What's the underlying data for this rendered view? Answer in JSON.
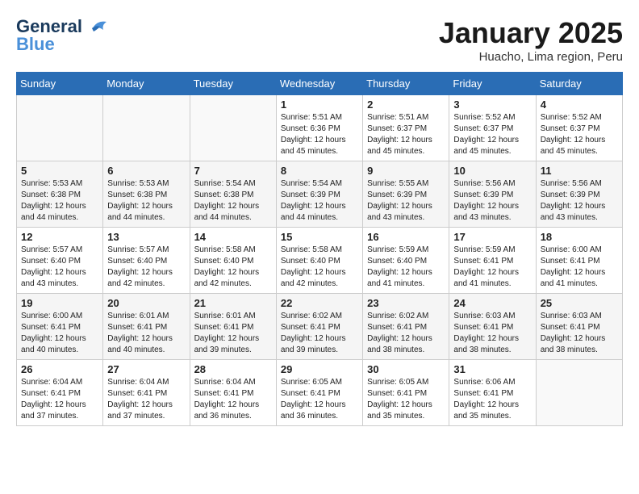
{
  "header": {
    "logo_line1": "General",
    "logo_line2": "Blue",
    "title": "January 2025",
    "subtitle": "Huacho, Lima region, Peru"
  },
  "weekdays": [
    "Sunday",
    "Monday",
    "Tuesday",
    "Wednesday",
    "Thursday",
    "Friday",
    "Saturday"
  ],
  "weeks": [
    [
      {
        "day": "",
        "sunrise": "",
        "sunset": "",
        "daylight": ""
      },
      {
        "day": "",
        "sunrise": "",
        "sunset": "",
        "daylight": ""
      },
      {
        "day": "",
        "sunrise": "",
        "sunset": "",
        "daylight": ""
      },
      {
        "day": "1",
        "sunrise": "Sunrise: 5:51 AM",
        "sunset": "Sunset: 6:36 PM",
        "daylight": "Daylight: 12 hours and 45 minutes."
      },
      {
        "day": "2",
        "sunrise": "Sunrise: 5:51 AM",
        "sunset": "Sunset: 6:37 PM",
        "daylight": "Daylight: 12 hours and 45 minutes."
      },
      {
        "day": "3",
        "sunrise": "Sunrise: 5:52 AM",
        "sunset": "Sunset: 6:37 PM",
        "daylight": "Daylight: 12 hours and 45 minutes."
      },
      {
        "day": "4",
        "sunrise": "Sunrise: 5:52 AM",
        "sunset": "Sunset: 6:37 PM",
        "daylight": "Daylight: 12 hours and 45 minutes."
      }
    ],
    [
      {
        "day": "5",
        "sunrise": "Sunrise: 5:53 AM",
        "sunset": "Sunset: 6:38 PM",
        "daylight": "Daylight: 12 hours and 44 minutes."
      },
      {
        "day": "6",
        "sunrise": "Sunrise: 5:53 AM",
        "sunset": "Sunset: 6:38 PM",
        "daylight": "Daylight: 12 hours and 44 minutes."
      },
      {
        "day": "7",
        "sunrise": "Sunrise: 5:54 AM",
        "sunset": "Sunset: 6:38 PM",
        "daylight": "Daylight: 12 hours and 44 minutes."
      },
      {
        "day": "8",
        "sunrise": "Sunrise: 5:54 AM",
        "sunset": "Sunset: 6:39 PM",
        "daylight": "Daylight: 12 hours and 44 minutes."
      },
      {
        "day": "9",
        "sunrise": "Sunrise: 5:55 AM",
        "sunset": "Sunset: 6:39 PM",
        "daylight": "Daylight: 12 hours and 43 minutes."
      },
      {
        "day": "10",
        "sunrise": "Sunrise: 5:56 AM",
        "sunset": "Sunset: 6:39 PM",
        "daylight": "Daylight: 12 hours and 43 minutes."
      },
      {
        "day": "11",
        "sunrise": "Sunrise: 5:56 AM",
        "sunset": "Sunset: 6:39 PM",
        "daylight": "Daylight: 12 hours and 43 minutes."
      }
    ],
    [
      {
        "day": "12",
        "sunrise": "Sunrise: 5:57 AM",
        "sunset": "Sunset: 6:40 PM",
        "daylight": "Daylight: 12 hours and 43 minutes."
      },
      {
        "day": "13",
        "sunrise": "Sunrise: 5:57 AM",
        "sunset": "Sunset: 6:40 PM",
        "daylight": "Daylight: 12 hours and 42 minutes."
      },
      {
        "day": "14",
        "sunrise": "Sunrise: 5:58 AM",
        "sunset": "Sunset: 6:40 PM",
        "daylight": "Daylight: 12 hours and 42 minutes."
      },
      {
        "day": "15",
        "sunrise": "Sunrise: 5:58 AM",
        "sunset": "Sunset: 6:40 PM",
        "daylight": "Daylight: 12 hours and 42 minutes."
      },
      {
        "day": "16",
        "sunrise": "Sunrise: 5:59 AM",
        "sunset": "Sunset: 6:40 PM",
        "daylight": "Daylight: 12 hours and 41 minutes."
      },
      {
        "day": "17",
        "sunrise": "Sunrise: 5:59 AM",
        "sunset": "Sunset: 6:41 PM",
        "daylight": "Daylight: 12 hours and 41 minutes."
      },
      {
        "day": "18",
        "sunrise": "Sunrise: 6:00 AM",
        "sunset": "Sunset: 6:41 PM",
        "daylight": "Daylight: 12 hours and 41 minutes."
      }
    ],
    [
      {
        "day": "19",
        "sunrise": "Sunrise: 6:00 AM",
        "sunset": "Sunset: 6:41 PM",
        "daylight": "Daylight: 12 hours and 40 minutes."
      },
      {
        "day": "20",
        "sunrise": "Sunrise: 6:01 AM",
        "sunset": "Sunset: 6:41 PM",
        "daylight": "Daylight: 12 hours and 40 minutes."
      },
      {
        "day": "21",
        "sunrise": "Sunrise: 6:01 AM",
        "sunset": "Sunset: 6:41 PM",
        "daylight": "Daylight: 12 hours and 39 minutes."
      },
      {
        "day": "22",
        "sunrise": "Sunrise: 6:02 AM",
        "sunset": "Sunset: 6:41 PM",
        "daylight": "Daylight: 12 hours and 39 minutes."
      },
      {
        "day": "23",
        "sunrise": "Sunrise: 6:02 AM",
        "sunset": "Sunset: 6:41 PM",
        "daylight": "Daylight: 12 hours and 38 minutes."
      },
      {
        "day": "24",
        "sunrise": "Sunrise: 6:03 AM",
        "sunset": "Sunset: 6:41 PM",
        "daylight": "Daylight: 12 hours and 38 minutes."
      },
      {
        "day": "25",
        "sunrise": "Sunrise: 6:03 AM",
        "sunset": "Sunset: 6:41 PM",
        "daylight": "Daylight: 12 hours and 38 minutes."
      }
    ],
    [
      {
        "day": "26",
        "sunrise": "Sunrise: 6:04 AM",
        "sunset": "Sunset: 6:41 PM",
        "daylight": "Daylight: 12 hours and 37 minutes."
      },
      {
        "day": "27",
        "sunrise": "Sunrise: 6:04 AM",
        "sunset": "Sunset: 6:41 PM",
        "daylight": "Daylight: 12 hours and 37 minutes."
      },
      {
        "day": "28",
        "sunrise": "Sunrise: 6:04 AM",
        "sunset": "Sunset: 6:41 PM",
        "daylight": "Daylight: 12 hours and 36 minutes."
      },
      {
        "day": "29",
        "sunrise": "Sunrise: 6:05 AM",
        "sunset": "Sunset: 6:41 PM",
        "daylight": "Daylight: 12 hours and 36 minutes."
      },
      {
        "day": "30",
        "sunrise": "Sunrise: 6:05 AM",
        "sunset": "Sunset: 6:41 PM",
        "daylight": "Daylight: 12 hours and 35 minutes."
      },
      {
        "day": "31",
        "sunrise": "Sunrise: 6:06 AM",
        "sunset": "Sunset: 6:41 PM",
        "daylight": "Daylight: 12 hours and 35 minutes."
      },
      {
        "day": "",
        "sunrise": "",
        "sunset": "",
        "daylight": ""
      }
    ]
  ]
}
